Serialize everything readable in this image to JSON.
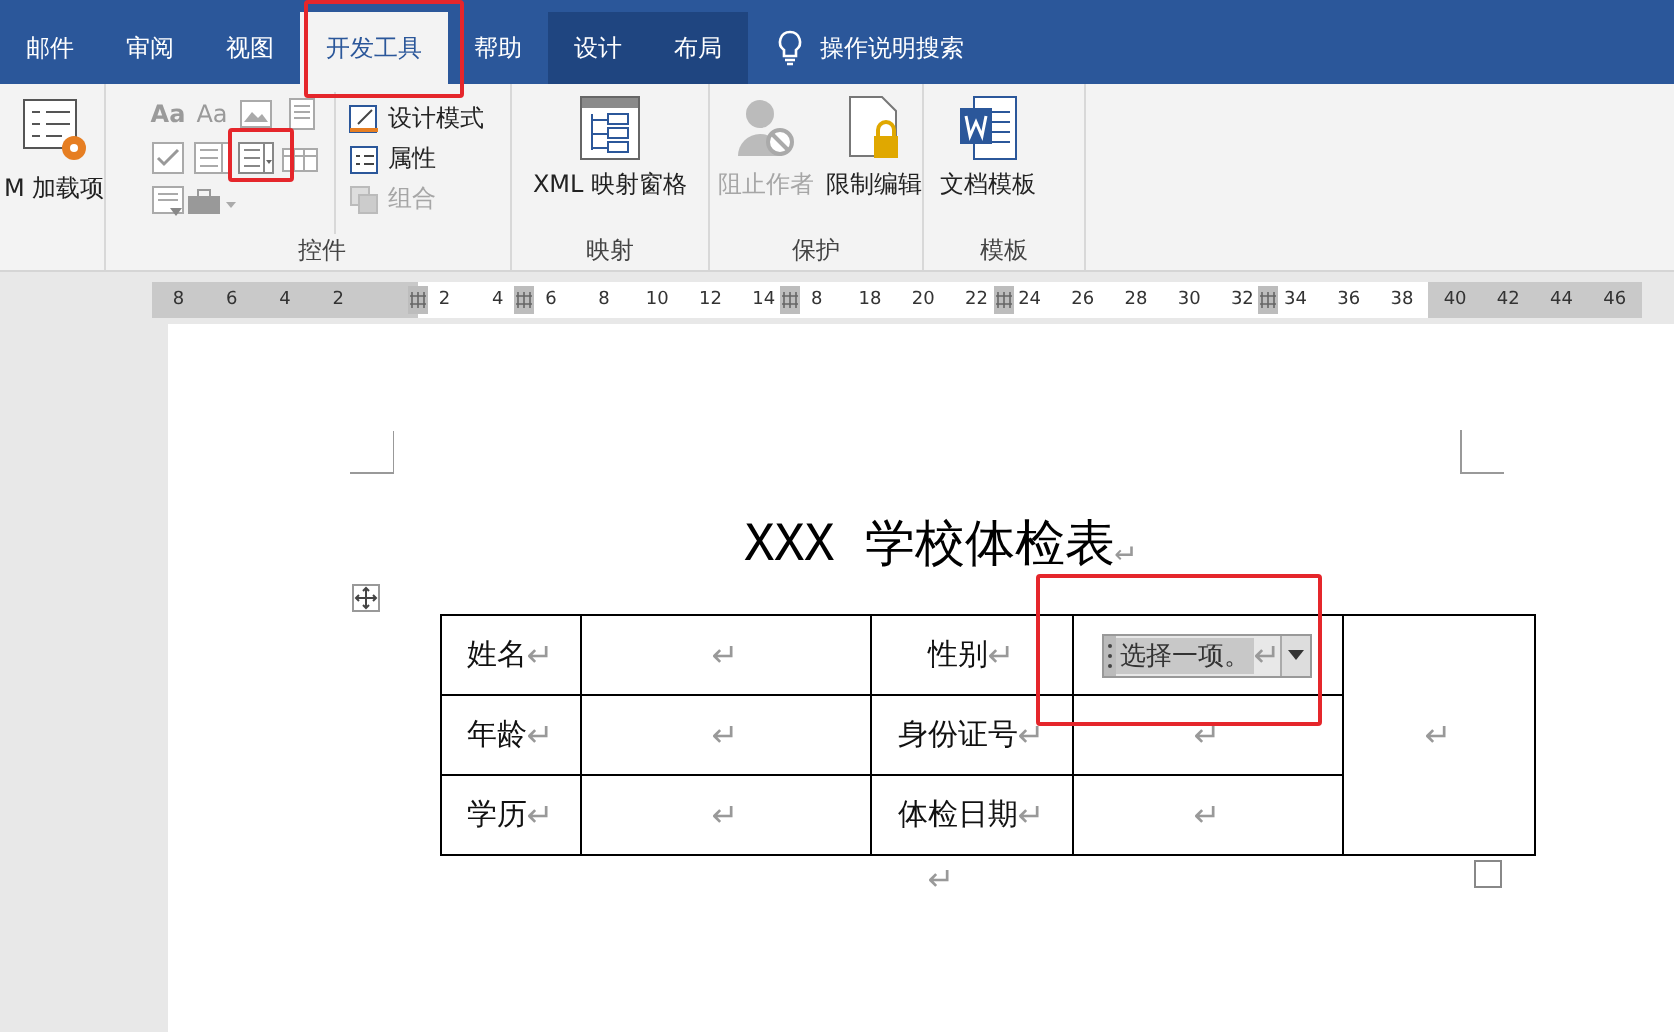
{
  "tabs": [
    {
      "label": "邮件",
      "selected": false,
      "contextual": false
    },
    {
      "label": "审阅",
      "selected": false,
      "contextual": false
    },
    {
      "label": "视图",
      "selected": false,
      "contextual": false
    },
    {
      "label": "开发工具",
      "selected": true,
      "contextual": false
    },
    {
      "label": "帮助",
      "selected": false,
      "contextual": false
    },
    {
      "label": "设计",
      "selected": false,
      "contextual": true
    },
    {
      "label": "布局",
      "selected": false,
      "contextual": true
    }
  ],
  "search": {
    "label": "操作说明搜索"
  },
  "ribbon": {
    "groups": [
      {
        "kind": "addins",
        "button": {
          "label": "M 加载项",
          "disabled": false
        }
      },
      {
        "kind": "controls",
        "label": "控件",
        "glyphs": [
          "Aa",
          "Aa"
        ],
        "commands": [
          {
            "label": "设计模式",
            "disabled": false
          },
          {
            "label": "属性",
            "disabled": false
          },
          {
            "label": "组合",
            "disabled": true
          }
        ]
      },
      {
        "kind": "mapping",
        "label": "映射",
        "button": {
          "label": "XML 映射窗格",
          "disabled": false
        }
      },
      {
        "kind": "protect",
        "label": "保护",
        "buttons": [
          {
            "label": "阻止作者",
            "disabled": true
          },
          {
            "label": "限制编辑",
            "disabled": false
          }
        ]
      },
      {
        "kind": "template",
        "label": "模板",
        "button": {
          "label": "文档模板",
          "disabled": false
        }
      }
    ]
  },
  "ruler": [
    {
      "kind": "number",
      "label": "8",
      "shaded": true
    },
    {
      "kind": "number",
      "label": "6",
      "shaded": true
    },
    {
      "kind": "number",
      "label": "4",
      "shaded": true
    },
    {
      "kind": "number",
      "label": "2",
      "shaded": true
    },
    {
      "kind": "gap",
      "shaded": true
    },
    {
      "kind": "marker"
    },
    {
      "kind": "number",
      "label": "2",
      "shaded": false
    },
    {
      "kind": "number",
      "label": "4",
      "shaded": false
    },
    {
      "kind": "marker"
    },
    {
      "kind": "number",
      "label": "6",
      "shaded": false
    },
    {
      "kind": "number",
      "label": "8",
      "shaded": false
    },
    {
      "kind": "number",
      "label": "10",
      "shaded": false
    },
    {
      "kind": "number",
      "label": "12",
      "shaded": false
    },
    {
      "kind": "number",
      "label": "14",
      "shaded": false
    },
    {
      "kind": "marker"
    },
    {
      "kind": "number",
      "label": "8",
      "shaded": false
    },
    {
      "kind": "number",
      "label": "18",
      "shaded": false
    },
    {
      "kind": "number",
      "label": "20",
      "shaded": false
    },
    {
      "kind": "number",
      "label": "22",
      "shaded": false
    },
    {
      "kind": "marker"
    },
    {
      "kind": "number",
      "label": "24",
      "shaded": false
    },
    {
      "kind": "number",
      "label": "26",
      "shaded": false
    },
    {
      "kind": "number",
      "label": "28",
      "shaded": false
    },
    {
      "kind": "number",
      "label": "30",
      "shaded": false
    },
    {
      "kind": "number",
      "label": "32",
      "shaded": false
    },
    {
      "kind": "marker"
    },
    {
      "kind": "number",
      "label": "34",
      "shaded": false
    },
    {
      "kind": "number",
      "label": "36",
      "shaded": false
    },
    {
      "kind": "number",
      "label": "38",
      "shaded": false
    },
    {
      "kind": "number",
      "label": "40",
      "shaded": true
    },
    {
      "kind": "number",
      "label": "42",
      "shaded": true
    },
    {
      "kind": "number",
      "label": "44",
      "shaded": true
    },
    {
      "kind": "number",
      "label": "46",
      "shaded": true
    }
  ],
  "document": {
    "title": "XXX 学校体检表",
    "title_mark": "↵",
    "after_mark": "↵",
    "table": {
      "rows": [
        [
          {
            "kind": "label",
            "text": "姓名",
            "mark": "↵"
          },
          {
            "kind": "value",
            "mark": "↵"
          },
          {
            "kind": "label",
            "text": "性别",
            "mark": "↵"
          },
          {
            "kind": "dropdown",
            "placeholder": "选择一项。",
            "mark": "↵"
          }
        ],
        [
          {
            "kind": "label",
            "text": "年龄",
            "mark": "↵"
          },
          {
            "kind": "value",
            "mark": "↵"
          },
          {
            "kind": "label",
            "text": "身份证号",
            "mark": "↵"
          },
          {
            "kind": "value",
            "mark": "↵"
          },
          {
            "kind": "photo",
            "mark": "↵"
          }
        ],
        [
          {
            "kind": "label",
            "text": "学历",
            "mark": "↵"
          },
          {
            "kind": "value",
            "mark": "↵"
          },
          {
            "kind": "label",
            "text": "体检日期",
            "mark": "↵"
          },
          {
            "kind": "value",
            "mark": "↵"
          }
        ]
      ]
    }
  }
}
